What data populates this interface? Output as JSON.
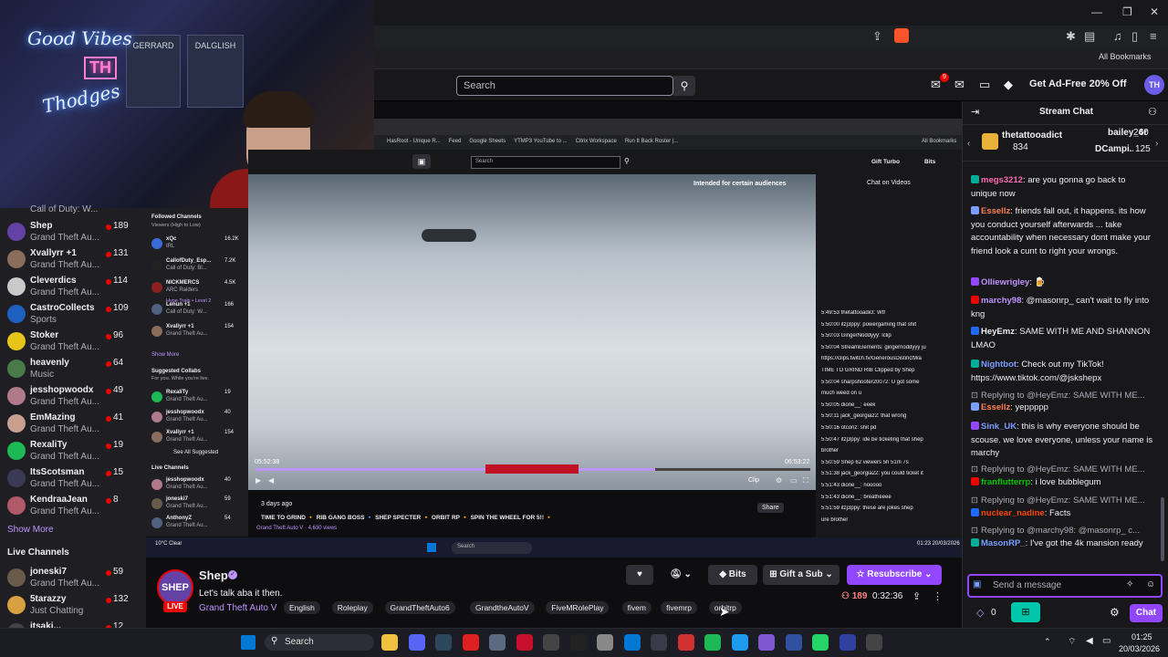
{
  "browser": {
    "bookmarks_label": "All Bookmarks",
    "window_controls": [
      "—",
      "❐",
      "✕"
    ]
  },
  "topnav": {
    "search_placeholder": "Search",
    "notifications_count": "9",
    "ad_free_label": "Get Ad-Free 20% Off",
    "avatar_initials": "TH"
  },
  "webcam": {
    "neon_line1": "Good Vibes",
    "neon_line2": "Thodges",
    "neon_logo": "TH",
    "jersey1": "GERRARD",
    "jersey2": "DALGLISH"
  },
  "left_sidebar": {
    "partial_top": "Call of Duty: W...",
    "channels": [
      {
        "name": "Shep",
        "game": "Grand Theft Au...",
        "viewers": "189",
        "color": "#6441a5"
      },
      {
        "name": "Xvallyrr +1",
        "game": "Grand Theft Au...",
        "viewers": "131",
        "color": "#8a6d5a"
      },
      {
        "name": "Cleverdics",
        "game": "Grand Theft Au...",
        "viewers": "114",
        "color": "#c9c9c9"
      },
      {
        "name": "CastroCollects",
        "game": "Sports",
        "viewers": "109",
        "color": "#1e5fbf"
      },
      {
        "name": "Stoker",
        "game": "Grand Theft Au...",
        "viewers": "96",
        "color": "#e8c31a"
      },
      {
        "name": "heavenly",
        "game": "Music",
        "viewers": "64",
        "color": "#4a7a4a"
      },
      {
        "name": "jesshopwoodx",
        "game": "Grand Theft Au...",
        "viewers": "49",
        "color": "#b07a8a"
      },
      {
        "name": "EmMazing",
        "game": "Grand Theft Au...",
        "viewers": "41",
        "color": "#c8a090"
      },
      {
        "name": "RexaliTy",
        "game": "Grand Theft Au...",
        "viewers": "19",
        "color": "#1db954"
      },
      {
        "name": "ItsScotsman",
        "game": "Grand Theft Au...",
        "viewers": "15",
        "color": "#3a3a55"
      },
      {
        "name": "KendraaJean",
        "game": "Grand Theft Au...",
        "viewers": "8",
        "color": "#b25a6a"
      }
    ],
    "show_more": "Show More",
    "live_channels_heading": "Live Channels",
    "live_channels": [
      {
        "name": "joneski7",
        "game": "Grand Theft Au...",
        "viewers": "59",
        "color": "#6a5a4a"
      },
      {
        "name": "5tarazzy",
        "game": "Just Chatting",
        "viewers": "132",
        "color": "#d8a040"
      },
      {
        "name": "itsaki...",
        "game": "",
        "viewers": "12",
        "color": "#444"
      }
    ]
  },
  "nested": {
    "search_placeholder": "Search",
    "bookmarks": [
      "HasRoot - Unique R...",
      "Feed",
      "Google Sheets",
      "YTMP3 YouTube to ...",
      "Citrix Workspace",
      "Run It Back Roster |..."
    ],
    "bookmarks_all": "All Bookmarks",
    "gift_turbo": "Gift Turbo",
    "bits": "Bits",
    "followed_heading": "Followed Channels",
    "followed_sub": "Viewers (High to Low)",
    "followed": [
      {
        "name": "xQc",
        "sub": "IRL",
        "count": "16.2K",
        "color": "#3a6ad8"
      },
      {
        "name": "CallofDuty_Esp...",
        "sub": "Call of Duty: Bl...",
        "count": "7.2K",
        "color": "#222"
      },
      {
        "name": "NICKMERCS",
        "sub": "ARC Raiders",
        "count": "4.5K",
        "color": "#8a2020"
      },
      {
        "name": "Lenun +1",
        "sub": "Call of Duty: W...",
        "count": "166",
        "color": "#506080"
      },
      {
        "name": "Xvallyrr +1",
        "sub": "Grand Theft Au...",
        "count": "154",
        "color": "#8a6d5a"
      }
    ],
    "hype_train": "Hype Train • Level 2",
    "ns_show_more": "Show More",
    "suggested_heading": "Suggested Collabs",
    "suggested_sub": "For you. While you're live.",
    "suggested": [
      {
        "name": "RexaliTy",
        "sub": "Grand Theft Au...",
        "count": "19",
        "color": "#1db954"
      },
      {
        "name": "jesshopwoodx",
        "sub": "Grand Theft Au...",
        "count": "40",
        "color": "#b07a8a"
      },
      {
        "name": "Xvallyrr +1",
        "sub": "Grand Theft Au...",
        "count": "154",
        "color": "#8a6d5a"
      }
    ],
    "see_all_suggested": "See All Suggested",
    "live_heading": "Live Channels",
    "live": [
      {
        "name": "jesshopwoodx",
        "sub": "Grand Theft Au...",
        "count": "40",
        "color": "#b07a8a"
      },
      {
        "name": "joneski7",
        "sub": "Grand Theft Au...",
        "count": "59",
        "color": "#6a5a4a"
      },
      {
        "name": "AnthonyZ",
        "sub": "Grand Theft Au...",
        "count": "54",
        "color": "#506080"
      }
    ],
    "audience_note": "Intended for certain audiences",
    "time_left": "05:52:38",
    "time_right": "06:53:22",
    "progress": 0.72,
    "clip": "Clip",
    "vod_date": "3 days ago",
    "vod_title": "TIME TO GRIND 🔸 RIB GANG BOSS 🔹 SHEP SPECTER 🔸 ORBIT RP 🔸 SPIN THE WHEEL FOR 5!! 🔸",
    "vod_sub": "Grand Theft Auto V · 4,630 views",
    "share": "Share",
    "chat_title": "Chat on Videos",
    "chat_lines": [
      "5:49:53  thetattooadict: Wtf",
      "5:50:00  itzj3ppy: powergaming that shit",
      "5:50:03  GingerNoddyyy: lclip",
      "5:50:04  StreamElements: gingernoddyyy ju",
      "https://clips.twitch.tv/GenerousDistinctWa",
      "TIME TO GRIND  RIB  Clipped by Shep",
      "5:50:04  sharpshooter20072: U got some",
      "much weed on u",
      "5:50:05  dione__: eeek",
      "5:50:11  jack_georgia22: that wrong",
      "5:50:16  otconz: shit pd",
      "5:50:47  itzj3ppy: ide be ticketing that shep",
      "brother",
      "5:50:59  Shep  62 viewers  5h 51m 7s",
      "5:51:38  jack_georgia22: you could ticket it",
      "5:51:43  dione__: nooooo",
      "5:51:43  dione__: breatheeee",
      "5:51:59  itzj3ppy: these are jokes shep",
      "ure brother"
    ],
    "taskbar_search": "Search",
    "weather": "10°C Clear",
    "clock": "01:23 20/03/2026"
  },
  "stream": {
    "streamer": "Shep",
    "avatar_text": "SHEP",
    "live_label": "LIVE",
    "title": "Let's talk aba it then.",
    "game": "Grand Theft Auto V",
    "tags": [
      "English",
      "Roleplay",
      "GrandTheftAuto6",
      "GrandtheAutoV",
      "FiveMRolePlay",
      "fivem",
      "fivemrp",
      "orbitrp"
    ],
    "bits_label": "Bits",
    "gift_label": "Gift a Sub",
    "resub_label": "Resubscribe",
    "viewers": "189",
    "uptime": "0:32:36"
  },
  "chat": {
    "title": "Stream Chat",
    "leaderboard": [
      {
        "name": "thetattooadict",
        "value": "834"
      },
      {
        "name": "bailey_6r",
        "value": "240"
      },
      {
        "name": "DCampi...",
        "value": "125"
      }
    ],
    "messages": [
      {
        "user": "megs3212",
        "color": "#ff69b4",
        "text": ": are you gonna go back to unique now"
      },
      {
        "user": "Essellz",
        "color": "#ff7f50",
        "text": ": friends fall out, it happens. its how you conduct yourself afterwards ... take accountability when necessary dont make your friend look a cunt to right your wrongs."
      },
      {
        "user": "Olliewrigley",
        "color": "#bf94ff",
        "text": ": 🍺"
      },
      {
        "user": "marchy98",
        "color": "#bf94ff",
        "text": ": @masonrp_ can't wait to fly into kng"
      },
      {
        "user": "HeyEmz",
        "color": "#efeff1",
        "text": ": SAME WITH ME AND SHANNON LMAO"
      },
      {
        "user": "Nightbot",
        "color": "#7b9dff",
        "text": ": Check out my TikTok! https://www.tiktok.com/@jskshepx"
      },
      {
        "user": "Essellz",
        "color": "#ff7f50",
        "text": ": yeppppp"
      },
      {
        "user": "Sink_UK",
        "color": "#7b9dff",
        "text": ": this is why everyone should be scouse. we love everyone, unless your name is marchy"
      },
      {
        "user": "franflutterrp",
        "color": "#00c800",
        "text": ": i love bubblegum"
      },
      {
        "user": "nuclear_nadine",
        "color": "#ff4500",
        "text": ": Facts"
      },
      {
        "user": "MasonRP_",
        "color": "#7b9dff",
        "text": ": I've got the 4k mansion ready"
      }
    ],
    "replies": [
      "Replying to @HeyEmz: SAME WITH ME...",
      "Replying to @HeyEmz: SAME WITH ME...",
      "Replying to @HeyEmz: SAME WITH ME...",
      "Replying to @marchy98: @masonrp_ c..."
    ],
    "input_placeholder": "Send a message",
    "points": "0",
    "chat_button": "Chat"
  },
  "taskbar": {
    "search": "Search",
    "time": "01:25",
    "date": "20/03/2026"
  }
}
